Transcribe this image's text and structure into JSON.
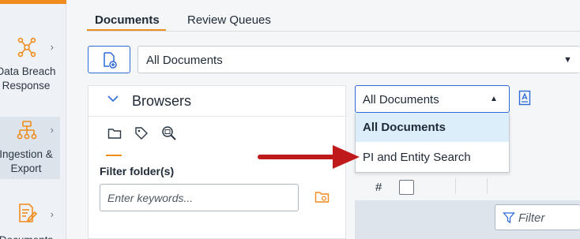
{
  "rail": {
    "items": [
      {
        "label_line1": "Data Breach",
        "label_line2": "Response"
      },
      {
        "label_line1": "Ingestion &",
        "label_line2": "Export"
      },
      {
        "label_line1": "Documents",
        "label_line2": ""
      }
    ]
  },
  "tabs": {
    "documents": "Documents",
    "review_queues": "Review Queues"
  },
  "scope": {
    "value": "All Documents"
  },
  "browsers": {
    "title": "Browsers",
    "filter_label": "Filter folder(s)",
    "keywords_placeholder": "Enter keywords..."
  },
  "dropdown": {
    "value": "All Documents",
    "options": [
      "All Documents",
      "PI and Entity Search"
    ]
  },
  "grid": {
    "hash_header": "#",
    "filter_placeholder": "Filter"
  },
  "colors": {
    "accent": "#f08c1e",
    "primary": "#2f6bd6",
    "annotation_arrow": "#c0191c"
  }
}
